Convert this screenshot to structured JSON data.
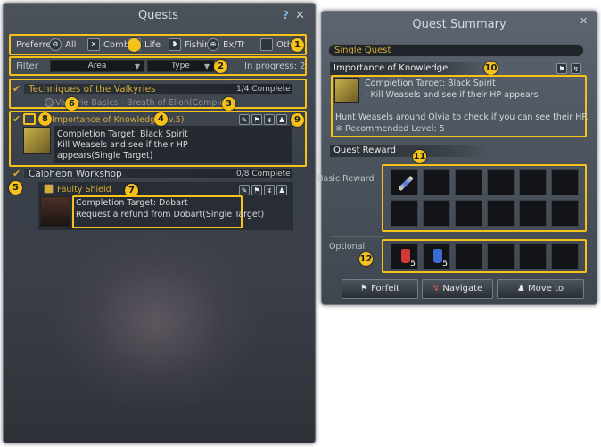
{
  "quests_window": {
    "title": "Quests",
    "help": "?",
    "close": "✕",
    "pref_label": "Preferred",
    "pref_types": [
      {
        "label": "All",
        "icon": "gears-icon"
      },
      {
        "label": "Combat",
        "icon": "swords-icon"
      },
      {
        "label": "Life",
        "icon": "life-icon"
      },
      {
        "label": "Fishing",
        "icon": "fish-icon"
      },
      {
        "label": "Ex/Tr",
        "icon": "compass-icon"
      },
      {
        "label": "Other",
        "icon": "ellipsis-icon"
      }
    ],
    "filter_label": "Filter",
    "area_select": "Area",
    "type_select": "Type",
    "in_progress": "In progress: 2",
    "group1": {
      "title": "Techniques of the Valkyries",
      "progress": "1/4 Complete"
    },
    "sub_quest": "Valkyrie Basics - Breath of Elion(Complete)",
    "quest1": {
      "title": "Importance of Knowledge(Lv.5)",
      "target": "Completion Target: Black Spirit",
      "desc": "Kill Weasels and see if their HP appears(Single Target)"
    },
    "group2": {
      "title": "Calpheon Workshop",
      "progress": "0/8 Complete"
    },
    "quest2": {
      "title": "Faulty Shield",
      "target": "Completion Target: Dobart",
      "desc": "Request a refund from Dobart(Single Target)"
    }
  },
  "summary_window": {
    "title": "Quest Summary",
    "close": "✕",
    "type_label": "Single Quest",
    "quest_title": "Importance of Knowledge",
    "target": "Completion Target: Black Spirit",
    "task": "- Kill Weasels and see if their HP appears",
    "description": "Hunt Weasels around Olvia to check if you can see their HP.",
    "recommended": "※ Recommended Level: 5",
    "reward_header": "Quest Reward",
    "basic_reward": "Basic Reward",
    "optional": "Optional",
    "optional_items": [
      {
        "count": "5"
      },
      {
        "count": "5"
      }
    ],
    "buttons": {
      "forfeit": "Forfeit",
      "navigate": "Navigate",
      "move_to": "Move to"
    }
  },
  "annotations": [
    "1",
    "2",
    "3",
    "4",
    "5",
    "6",
    "7",
    "8",
    "9",
    "10",
    "11",
    "12"
  ],
  "colors": {
    "highlight": "#f6c21a",
    "quest_title": "#d6ac36",
    "panel": "#3b4149"
  }
}
